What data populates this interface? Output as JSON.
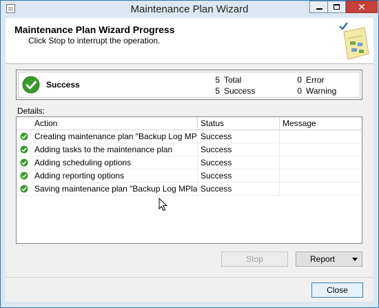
{
  "window": {
    "title": "Maintenance Plan Wizard"
  },
  "window_buttons": {
    "close": "✕"
  },
  "header": {
    "title": "Maintenance Plan Wizard Progress",
    "subtitle": "Click Stop to interrupt the operation."
  },
  "summary": {
    "status": "Success",
    "total_count": "5",
    "total_label": "Total",
    "success_count": "5",
    "success_label": "Success",
    "error_count": "0",
    "error_label": "Error",
    "warning_count": "0",
    "warning_label": "Warning"
  },
  "details": {
    "label": "Details:",
    "columns": [
      "Action",
      "Status",
      "Message"
    ],
    "rows": [
      {
        "action": "Creating maintenance plan \"Backup Log MPl...",
        "status": "Success",
        "message": ""
      },
      {
        "action": "Adding tasks to the maintenance plan",
        "status": "Success",
        "message": ""
      },
      {
        "action": "Adding scheduling options",
        "status": "Success",
        "message": ""
      },
      {
        "action": "Adding reporting options",
        "status": "Success",
        "message": ""
      },
      {
        "action": "Saving maintenance plan \"Backup Log MPlan\"",
        "status": "Success",
        "message": ""
      }
    ]
  },
  "buttons": {
    "stop": "Stop",
    "report": "Report",
    "close": "Close"
  },
  "icons": {
    "status": "check-circle-icon",
    "header": "wizard-graphic-icon"
  },
  "colors": {
    "success_green": "#3a9a2a",
    "title_bg": "#dbe7f3",
    "close_red": "#c7403a"
  }
}
